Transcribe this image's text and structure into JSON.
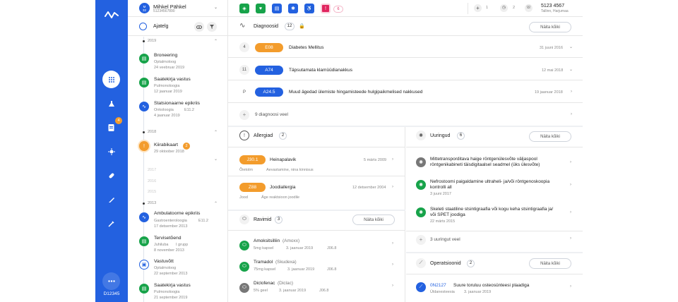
{
  "app": {
    "id_label": "D12345"
  },
  "colors": {
    "rail": "#2361e0",
    "green": "#17a34a",
    "blue": "#2361e0",
    "orange": "#f39c2c",
    "grey": "#777"
  },
  "rail": {
    "items": [
      {
        "icon": "grid-icon"
      },
      {
        "icon": "flask-icon"
      },
      {
        "icon": "clipboard-icon",
        "badge": "4"
      },
      {
        "icon": "virus-icon"
      },
      {
        "icon": "pill-icon"
      },
      {
        "icon": "scalpel-icon"
      },
      {
        "icon": "syringe-icon"
      },
      {
        "icon": "more-icon"
      }
    ]
  },
  "patient": {
    "age": "M\n32",
    "name": "Mihkel Pähkel",
    "code": "51234567890"
  },
  "timeline": {
    "title": "Ajatelg",
    "years": {
      "y2019": "2019",
      "y2018": "2018",
      "y2017": "2017",
      "y2016": "2016",
      "y2015": "2015",
      "y2013": "2013"
    },
    "items": [
      {
        "title": "Broneering",
        "sub1": "Optalmoloog",
        "sub2": "24 veebruar 2019"
      },
      {
        "title": "Saatekirja vastus",
        "sub1": "Pulmonoloogia",
        "sub2": "12 jaanuar 2019"
      },
      {
        "title": "Statsionaarne epikriis",
        "sub1": "Onkoloogia",
        "sub1b": "E11.2",
        "sub2": "4 jaanuar 2019"
      },
      {
        "title": "Kiirabikaart",
        "badge": "2",
        "sub2": "29 oktoober 2018"
      },
      {
        "title": "Ambulatoorne epikriis",
        "sub1": "Gastroenteroloogia",
        "sub1b": "E11.2",
        "sub2": "17 detsember 2013"
      },
      {
        "title": "Tervisetõend",
        "sub1": "Juhiluba",
        "sub1b": "I grupp",
        "sub2": "8 november 2013"
      },
      {
        "title": "Vastuvõtt",
        "sub1": "Optalmoloog",
        "sub2": "22 september 2013"
      },
      {
        "title": "Saatekirja vastus",
        "sub1": "Pulmonoloogia",
        "sub2": "21 september 2019"
      }
    ]
  },
  "topbar": {
    "badge_count": "6",
    "plus_count": "1",
    "clock_count": "2",
    "phone": "5123 4567",
    "address": "Tallinn, Harjumaa"
  },
  "diagnoses": {
    "title": "Diagnoosid",
    "count": "12",
    "show_all": "Näita kõiki",
    "more": "9 diagnoosi veel",
    "rows": [
      {
        "num": "4",
        "code": "E08",
        "text": "Diabetes Mellitus",
        "date": "31 juuni 2016"
      },
      {
        "num": "11",
        "code": "A74",
        "text": "Täpsutamata klamüüdianakkus",
        "date": "12 mai 2018"
      },
      {
        "num": "P",
        "code": "A24.5",
        "text": "Muud ägedad ülemiste hingamisteede hulgipaikmelised nakkused",
        "date": "19 jaanuar 2018"
      }
    ]
  },
  "allergies": {
    "title": "Allergiad",
    "count": "2",
    "rows": [
      {
        "code": "J30.1",
        "text": "Heinapalavik",
        "date": "5 märts 2009",
        "sub1": "Õietolm",
        "sub2": "Aevastamine, nina kinnisus"
      },
      {
        "code": "Z88",
        "text": "Joodiallergia",
        "date": "12 detsember 2004",
        "sub1": "Jood",
        "sub2": "Äge reaktsioon joodile"
      }
    ]
  },
  "drugs": {
    "title": "Ravimid",
    "count": "3",
    "show_all": "Näita kõiki",
    "rows": [
      {
        "name": "Amoksitsilliin",
        "alt": "(Amoxx)",
        "dose": "5mg kapsel",
        "date": "3. jaanuar 2019",
        "code": "J06.8"
      },
      {
        "name": "Tramadol",
        "alt": "(Skudexa)",
        "dose": "75mg kapsel",
        "date": "3. jaanuar 2019",
        "code": "J06.8"
      },
      {
        "name": "Diclofenac",
        "alt": "(Diclac)",
        "dose": "5% geel",
        "date": "3. jaanuar 2019",
        "code": "J06.8"
      }
    ]
  },
  "studies": {
    "title": "Uuringud",
    "count": "6",
    "show_all": "Näita kõiki",
    "more": "3 uuringut veel",
    "rows": [
      {
        "line1": "Mittetransporditava haige röntgenülesvõte väljaspool",
        "line2": "röntgenikabineti täisdigitaalsel seadmel (üks ülesvõte)",
        "date": ""
      },
      {
        "line1": "Nefrostoomi paigaldamine ultraheli- ja/või röntgenoskoopia",
        "line2": "kontrolli all",
        "date": "3 juuni 2017"
      },
      {
        "line1": "Skeleti staatiline stsintigraafia või kogu keha stsintigraafia ja/",
        "line2": "või SPET joodiga",
        "date": "22 märts 2015"
      }
    ]
  },
  "operations": {
    "title": "Operatsioonid",
    "count": "2",
    "show_all": "Näita kõiki",
    "rows": [
      {
        "code": "0N2127",
        "text": "Suure toruluu osteosünteesi plaadiga",
        "sub1": "Üldanesteesia",
        "date": "3. jaanuar 2019"
      }
    ]
  }
}
